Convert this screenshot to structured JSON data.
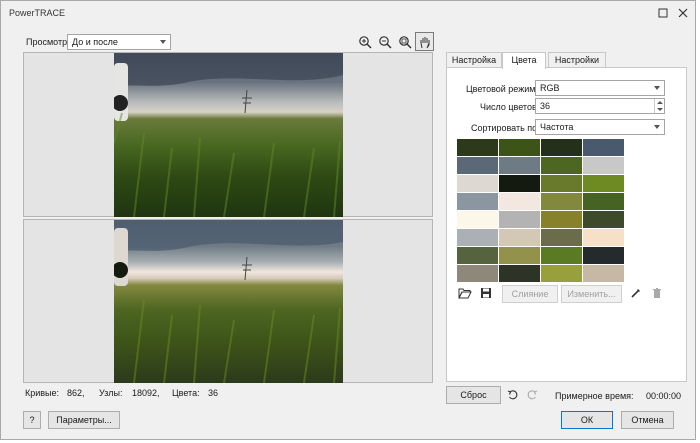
{
  "window": {
    "title": "PowerTRACE"
  },
  "preview": {
    "label": "Просмотр:",
    "mode": "До и после"
  },
  "tabs": [
    {
      "label": "Настройка",
      "active": false
    },
    {
      "label": "Цвета",
      "active": true
    },
    {
      "label": "Настройки",
      "active": false
    }
  ],
  "colors": {
    "mode_label": "Цветовой режим:",
    "mode_value": "RGB",
    "count_label": "Число цветов:",
    "count_value": "36",
    "sort_label": "Сортировать по:",
    "sort_value": "Частота",
    "swatches": [
      "#2c3a1b",
      "#3d5418",
      "#243019",
      "#4a5a6e",
      "#5b6878",
      "#6f7b84",
      "#4d6621",
      "#c8c8c8",
      "#ddd8d2",
      "#151a10",
      "#6a7a2c",
      "#6d8a23",
      "#8b96a0",
      "#f3e8df",
      "#83883f",
      "#456423",
      "#fbf8ea",
      "#b3b3b3",
      "#88812c",
      "#3e4b2b",
      "#aab0b4",
      "#d3c7b6",
      "#6b6d4a",
      "#f7e0c8",
      "#55633f",
      "#93924d",
      "#5a7b23",
      "#252b2c",
      "#8d887a",
      "#2e3327",
      "#98a03d",
      "#c6b8a4"
    ],
    "merge_button": "Слияние",
    "edit_button": "Изменить..."
  },
  "stats": {
    "curves_label": "Кривые:",
    "curves_value": "862,",
    "nodes_label": "Узлы:",
    "nodes_value": "18092,",
    "colors_label": "Цвета:",
    "colors_value": "36"
  },
  "footer": {
    "reset_button": "Сброс",
    "time_label": "Примерное время:",
    "time_value": "00:00:00",
    "help_button": "?",
    "params_button": "Параметры...",
    "ok_button": "ОК",
    "cancel_button": "Отмена"
  }
}
